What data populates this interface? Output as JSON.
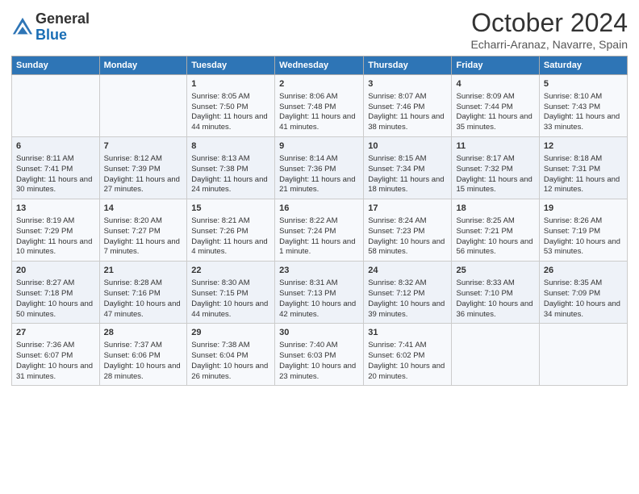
{
  "header": {
    "logo_line1": "General",
    "logo_line2": "Blue",
    "month": "October 2024",
    "subtitle": "Echarri-Aranaz, Navarre, Spain"
  },
  "days_of_week": [
    "Sunday",
    "Monday",
    "Tuesday",
    "Wednesday",
    "Thursday",
    "Friday",
    "Saturday"
  ],
  "weeks": [
    [
      {
        "day": "",
        "info": ""
      },
      {
        "day": "",
        "info": ""
      },
      {
        "day": "1",
        "info": "Sunrise: 8:05 AM\nSunset: 7:50 PM\nDaylight: 11 hours and 44 minutes."
      },
      {
        "day": "2",
        "info": "Sunrise: 8:06 AM\nSunset: 7:48 PM\nDaylight: 11 hours and 41 minutes."
      },
      {
        "day": "3",
        "info": "Sunrise: 8:07 AM\nSunset: 7:46 PM\nDaylight: 11 hours and 38 minutes."
      },
      {
        "day": "4",
        "info": "Sunrise: 8:09 AM\nSunset: 7:44 PM\nDaylight: 11 hours and 35 minutes."
      },
      {
        "day": "5",
        "info": "Sunrise: 8:10 AM\nSunset: 7:43 PM\nDaylight: 11 hours and 33 minutes."
      }
    ],
    [
      {
        "day": "6",
        "info": "Sunrise: 8:11 AM\nSunset: 7:41 PM\nDaylight: 11 hours and 30 minutes."
      },
      {
        "day": "7",
        "info": "Sunrise: 8:12 AM\nSunset: 7:39 PM\nDaylight: 11 hours and 27 minutes."
      },
      {
        "day": "8",
        "info": "Sunrise: 8:13 AM\nSunset: 7:38 PM\nDaylight: 11 hours and 24 minutes."
      },
      {
        "day": "9",
        "info": "Sunrise: 8:14 AM\nSunset: 7:36 PM\nDaylight: 11 hours and 21 minutes."
      },
      {
        "day": "10",
        "info": "Sunrise: 8:15 AM\nSunset: 7:34 PM\nDaylight: 11 hours and 18 minutes."
      },
      {
        "day": "11",
        "info": "Sunrise: 8:17 AM\nSunset: 7:32 PM\nDaylight: 11 hours and 15 minutes."
      },
      {
        "day": "12",
        "info": "Sunrise: 8:18 AM\nSunset: 7:31 PM\nDaylight: 11 hours and 12 minutes."
      }
    ],
    [
      {
        "day": "13",
        "info": "Sunrise: 8:19 AM\nSunset: 7:29 PM\nDaylight: 11 hours and 10 minutes."
      },
      {
        "day": "14",
        "info": "Sunrise: 8:20 AM\nSunset: 7:27 PM\nDaylight: 11 hours and 7 minutes."
      },
      {
        "day": "15",
        "info": "Sunrise: 8:21 AM\nSunset: 7:26 PM\nDaylight: 11 hours and 4 minutes."
      },
      {
        "day": "16",
        "info": "Sunrise: 8:22 AM\nSunset: 7:24 PM\nDaylight: 11 hours and 1 minute."
      },
      {
        "day": "17",
        "info": "Sunrise: 8:24 AM\nSunset: 7:23 PM\nDaylight: 10 hours and 58 minutes."
      },
      {
        "day": "18",
        "info": "Sunrise: 8:25 AM\nSunset: 7:21 PM\nDaylight: 10 hours and 56 minutes."
      },
      {
        "day": "19",
        "info": "Sunrise: 8:26 AM\nSunset: 7:19 PM\nDaylight: 10 hours and 53 minutes."
      }
    ],
    [
      {
        "day": "20",
        "info": "Sunrise: 8:27 AM\nSunset: 7:18 PM\nDaylight: 10 hours and 50 minutes."
      },
      {
        "day": "21",
        "info": "Sunrise: 8:28 AM\nSunset: 7:16 PM\nDaylight: 10 hours and 47 minutes."
      },
      {
        "day": "22",
        "info": "Sunrise: 8:30 AM\nSunset: 7:15 PM\nDaylight: 10 hours and 44 minutes."
      },
      {
        "day": "23",
        "info": "Sunrise: 8:31 AM\nSunset: 7:13 PM\nDaylight: 10 hours and 42 minutes."
      },
      {
        "day": "24",
        "info": "Sunrise: 8:32 AM\nSunset: 7:12 PM\nDaylight: 10 hours and 39 minutes."
      },
      {
        "day": "25",
        "info": "Sunrise: 8:33 AM\nSunset: 7:10 PM\nDaylight: 10 hours and 36 minutes."
      },
      {
        "day": "26",
        "info": "Sunrise: 8:35 AM\nSunset: 7:09 PM\nDaylight: 10 hours and 34 minutes."
      }
    ],
    [
      {
        "day": "27",
        "info": "Sunrise: 7:36 AM\nSunset: 6:07 PM\nDaylight: 10 hours and 31 minutes."
      },
      {
        "day": "28",
        "info": "Sunrise: 7:37 AM\nSunset: 6:06 PM\nDaylight: 10 hours and 28 minutes."
      },
      {
        "day": "29",
        "info": "Sunrise: 7:38 AM\nSunset: 6:04 PM\nDaylight: 10 hours and 26 minutes."
      },
      {
        "day": "30",
        "info": "Sunrise: 7:40 AM\nSunset: 6:03 PM\nDaylight: 10 hours and 23 minutes."
      },
      {
        "day": "31",
        "info": "Sunrise: 7:41 AM\nSunset: 6:02 PM\nDaylight: 10 hours and 20 minutes."
      },
      {
        "day": "",
        "info": ""
      },
      {
        "day": "",
        "info": ""
      }
    ]
  ]
}
